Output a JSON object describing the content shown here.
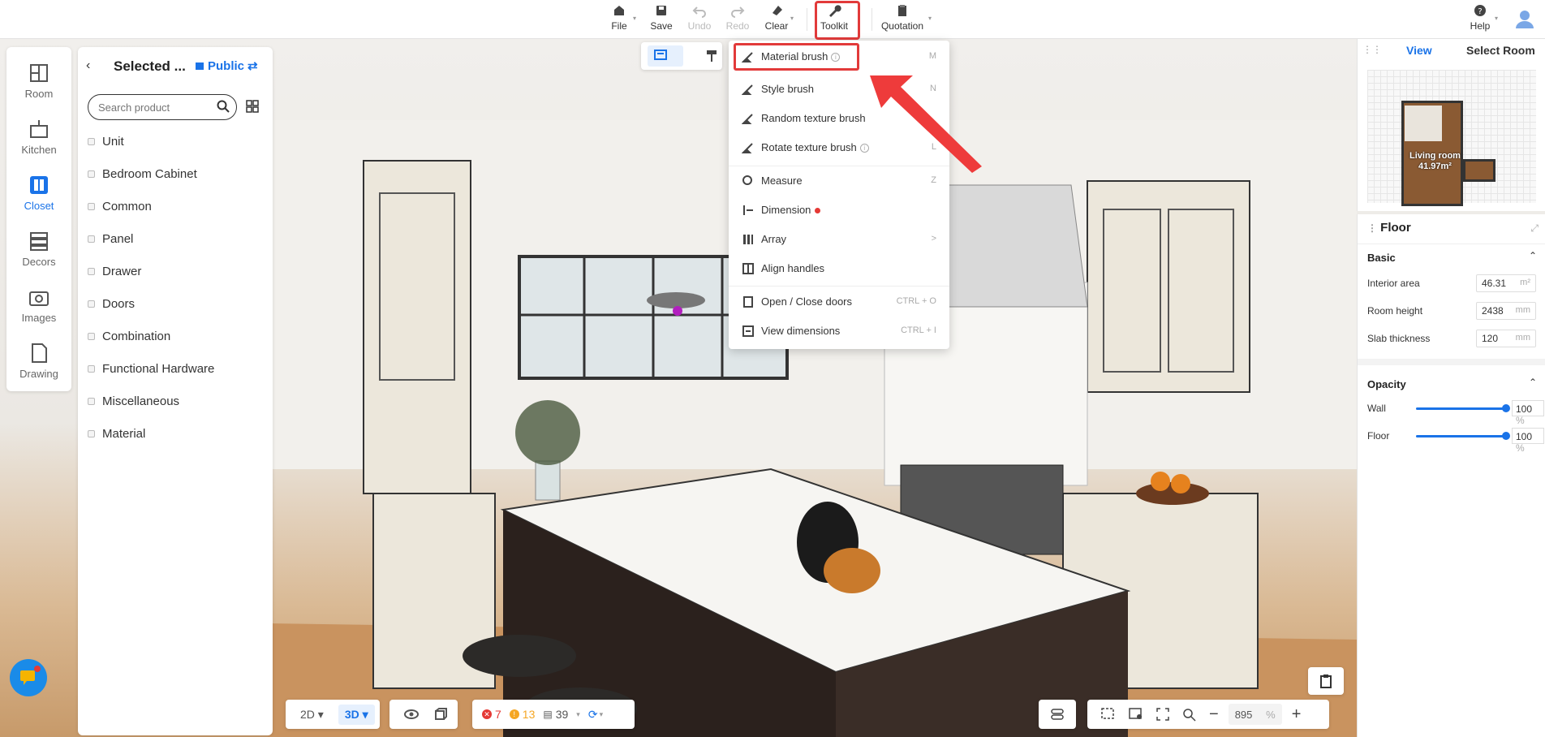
{
  "toolbar": {
    "file": "File",
    "save": "Save",
    "undo": "Undo",
    "redo": "Redo",
    "clear": "Clear",
    "toolkit": "Toolkit",
    "quotation": "Quotation",
    "help": "Help"
  },
  "rail": [
    {
      "label": "Room",
      "icon": "room-icon"
    },
    {
      "label": "Kitchen",
      "icon": "kitchen-icon"
    },
    {
      "label": "Closet",
      "icon": "closet-icon",
      "active": true
    },
    {
      "label": "Decors",
      "icon": "decors-icon"
    },
    {
      "label": "Images",
      "icon": "camera-icon"
    },
    {
      "label": "Drawing",
      "icon": "drawing-icon"
    }
  ],
  "panel": {
    "title": "Selected ...",
    "public": "Public",
    "search_placeholder": "Search product",
    "categories": [
      "Unit",
      "Bedroom Cabinet",
      "Common",
      "Panel",
      "Drawer",
      "Doors",
      "Combination",
      "Functional Hardware",
      "Miscellaneous",
      "Material"
    ]
  },
  "menu": {
    "items": [
      {
        "label": "Material brush",
        "key": "M",
        "info": true
      },
      {
        "label": "Style brush",
        "key": "N"
      },
      {
        "label": "Random texture brush",
        "key": ""
      },
      {
        "label": "Rotate texture brush",
        "key": "L",
        "info": true
      },
      {
        "label": "Measure",
        "key": "Z"
      },
      {
        "label": "Dimension",
        "key": "",
        "dot": true
      },
      {
        "label": "Array",
        "key": ">"
      },
      {
        "label": "Align handles",
        "key": ""
      },
      {
        "label": "Open / Close doors",
        "key": "CTRL + O"
      },
      {
        "label": "View dimensions",
        "key": "CTRL + I"
      }
    ]
  },
  "right": {
    "tab_view": "View",
    "tab_select": "Select Room",
    "room_label": "Living room",
    "room_area": "41.97m²",
    "floor_title": "Floor",
    "basic": "Basic",
    "interior_area_label": "Interior area",
    "interior_area": "46.31",
    "interior_area_unit": "m²",
    "room_height_label": "Room height",
    "room_height": "2438",
    "room_height_unit": "mm",
    "slab_label": "Slab thickness",
    "slab": "120",
    "slab_unit": "mm",
    "opacity": "Opacity",
    "wall_label": "Wall",
    "wall_value": "100",
    "floor_label": "Floor",
    "floor_value": "100",
    "pct": "%"
  },
  "bottom": {
    "mode_2d": "2D",
    "mode_3d": "3D",
    "errors": "7",
    "warnings": "13",
    "items": "39",
    "zoom": "895",
    "zoom_unit": "%"
  }
}
